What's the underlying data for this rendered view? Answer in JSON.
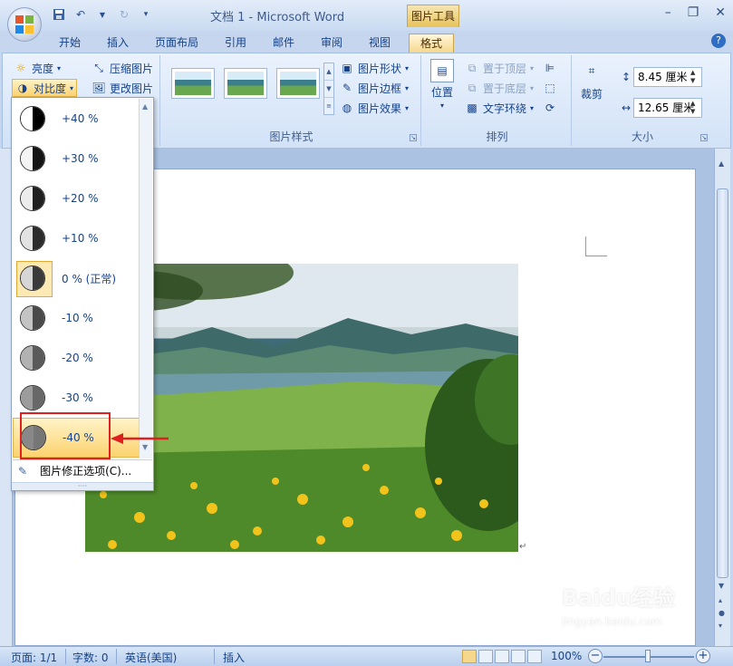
{
  "window": {
    "title": "文档 1 - Microsoft Word",
    "context_tab": "图片工具"
  },
  "ribbon_tabs": [
    "开始",
    "插入",
    "页面布局",
    "引用",
    "邮件",
    "审阅",
    "视图",
    "格式"
  ],
  "adjust": {
    "brightness": "亮度",
    "contrast": "对比度",
    "compress": "压缩图片",
    "change": "更改图片"
  },
  "picture_styles": {
    "label": "图片样式",
    "shape": "图片形状",
    "border": "图片边框",
    "effects": "图片效果"
  },
  "arrange": {
    "label": "排列",
    "position": "位置",
    "bring_front": "置于顶层",
    "send_back": "置于底层",
    "text_wrap": "文字环绕"
  },
  "size": {
    "label": "大小",
    "crop": "裁剪",
    "height": "8.45 厘米",
    "width": "12.65 厘米"
  },
  "contrast_menu": {
    "items": [
      "+40 %",
      "+30 %",
      "+20 %",
      "+10 %",
      "0 % (正常)",
      "-10 %",
      "-20 %",
      "-30 %",
      "-40 %"
    ],
    "levels": [
      40,
      30,
      20,
      10,
      0,
      -10,
      -20,
      -30,
      -40
    ],
    "options_label": "图片修正选项(C)..."
  },
  "status": {
    "page": "页面: 1/1",
    "words": "字数: 0",
    "language": "英语(美国)",
    "mode": "插入",
    "zoom": "100%"
  },
  "watermark": {
    "brand": "Baidu经验",
    "url": "jingyan.baidu.com"
  },
  "colors": {
    "accent": "#15428b",
    "highlight": "#e02020",
    "selected": "#fcd36f"
  }
}
